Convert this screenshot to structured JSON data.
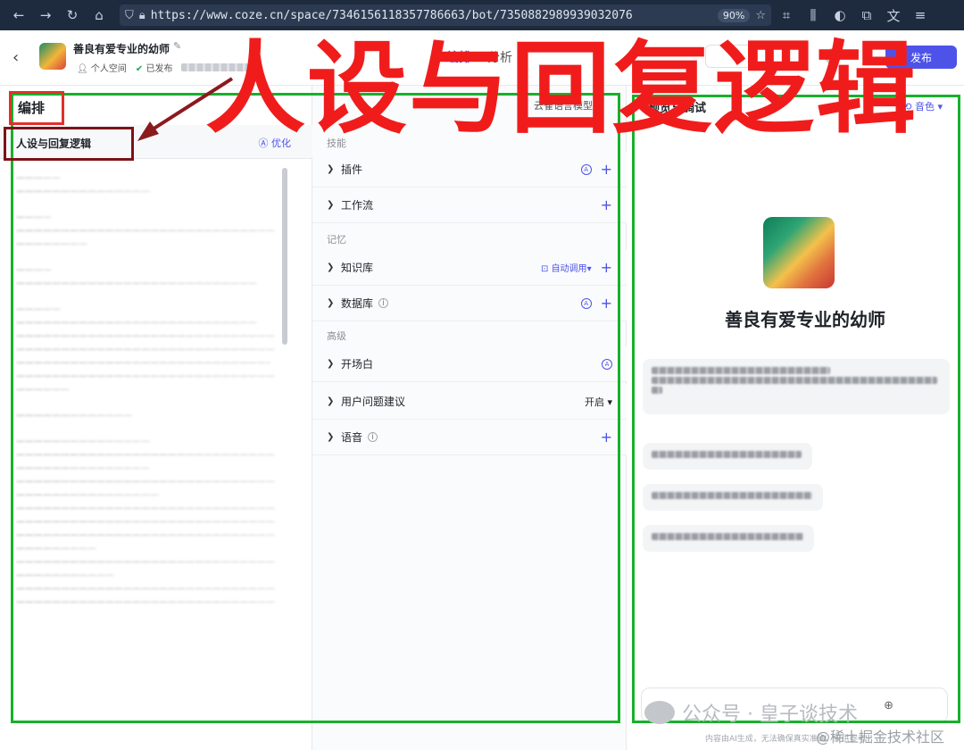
{
  "browser": {
    "url": "https://www.coze.cn/space/7346156118357786663/bot/7350882989939032076",
    "zoom": "90%"
  },
  "header": {
    "back_icon": "arrow-left-icon",
    "bot_name": "善良有爱专业的幼师",
    "workspace": "个人空间",
    "status": "已发布",
    "tabs": [
      {
        "label": "编排",
        "active": true
      },
      {
        "label": "分析",
        "active": false
      }
    ],
    "publish_label": "发布",
    "accent": "#4d53e8"
  },
  "prompt_panel": {
    "section_title": "编排",
    "block_title": "人设与回复逻辑",
    "optimize_label": "优化"
  },
  "skills_panel": {
    "model_label": "云雀语言模型",
    "groups": {
      "skills": "技能",
      "memory": "记忆",
      "advanced": "高级"
    },
    "rows": {
      "plugins": "插件",
      "workflow": "工作流",
      "knowledge": "知识库",
      "knowledge_right": "自动调用",
      "database": "数据库",
      "opening": "开场白",
      "suggestions": "用户问题建议",
      "suggestions_value": "开启",
      "voice": "语音"
    }
  },
  "preview_panel": {
    "title": "预览与调试",
    "voice_label": "音色",
    "bot_name": "善良有爱专业的幼师"
  },
  "annotation": {
    "big_text": "人设与回复逻辑",
    "frame_color": "#18b02c",
    "text_color": "#f01c1c"
  },
  "watermarks": {
    "gzh": "公众号 · 皇子谈技术",
    "disclaimer": "内容由AI生成，无法确保真实准确，仅供参考",
    "juejin": "@稀土掘金技术社区"
  }
}
